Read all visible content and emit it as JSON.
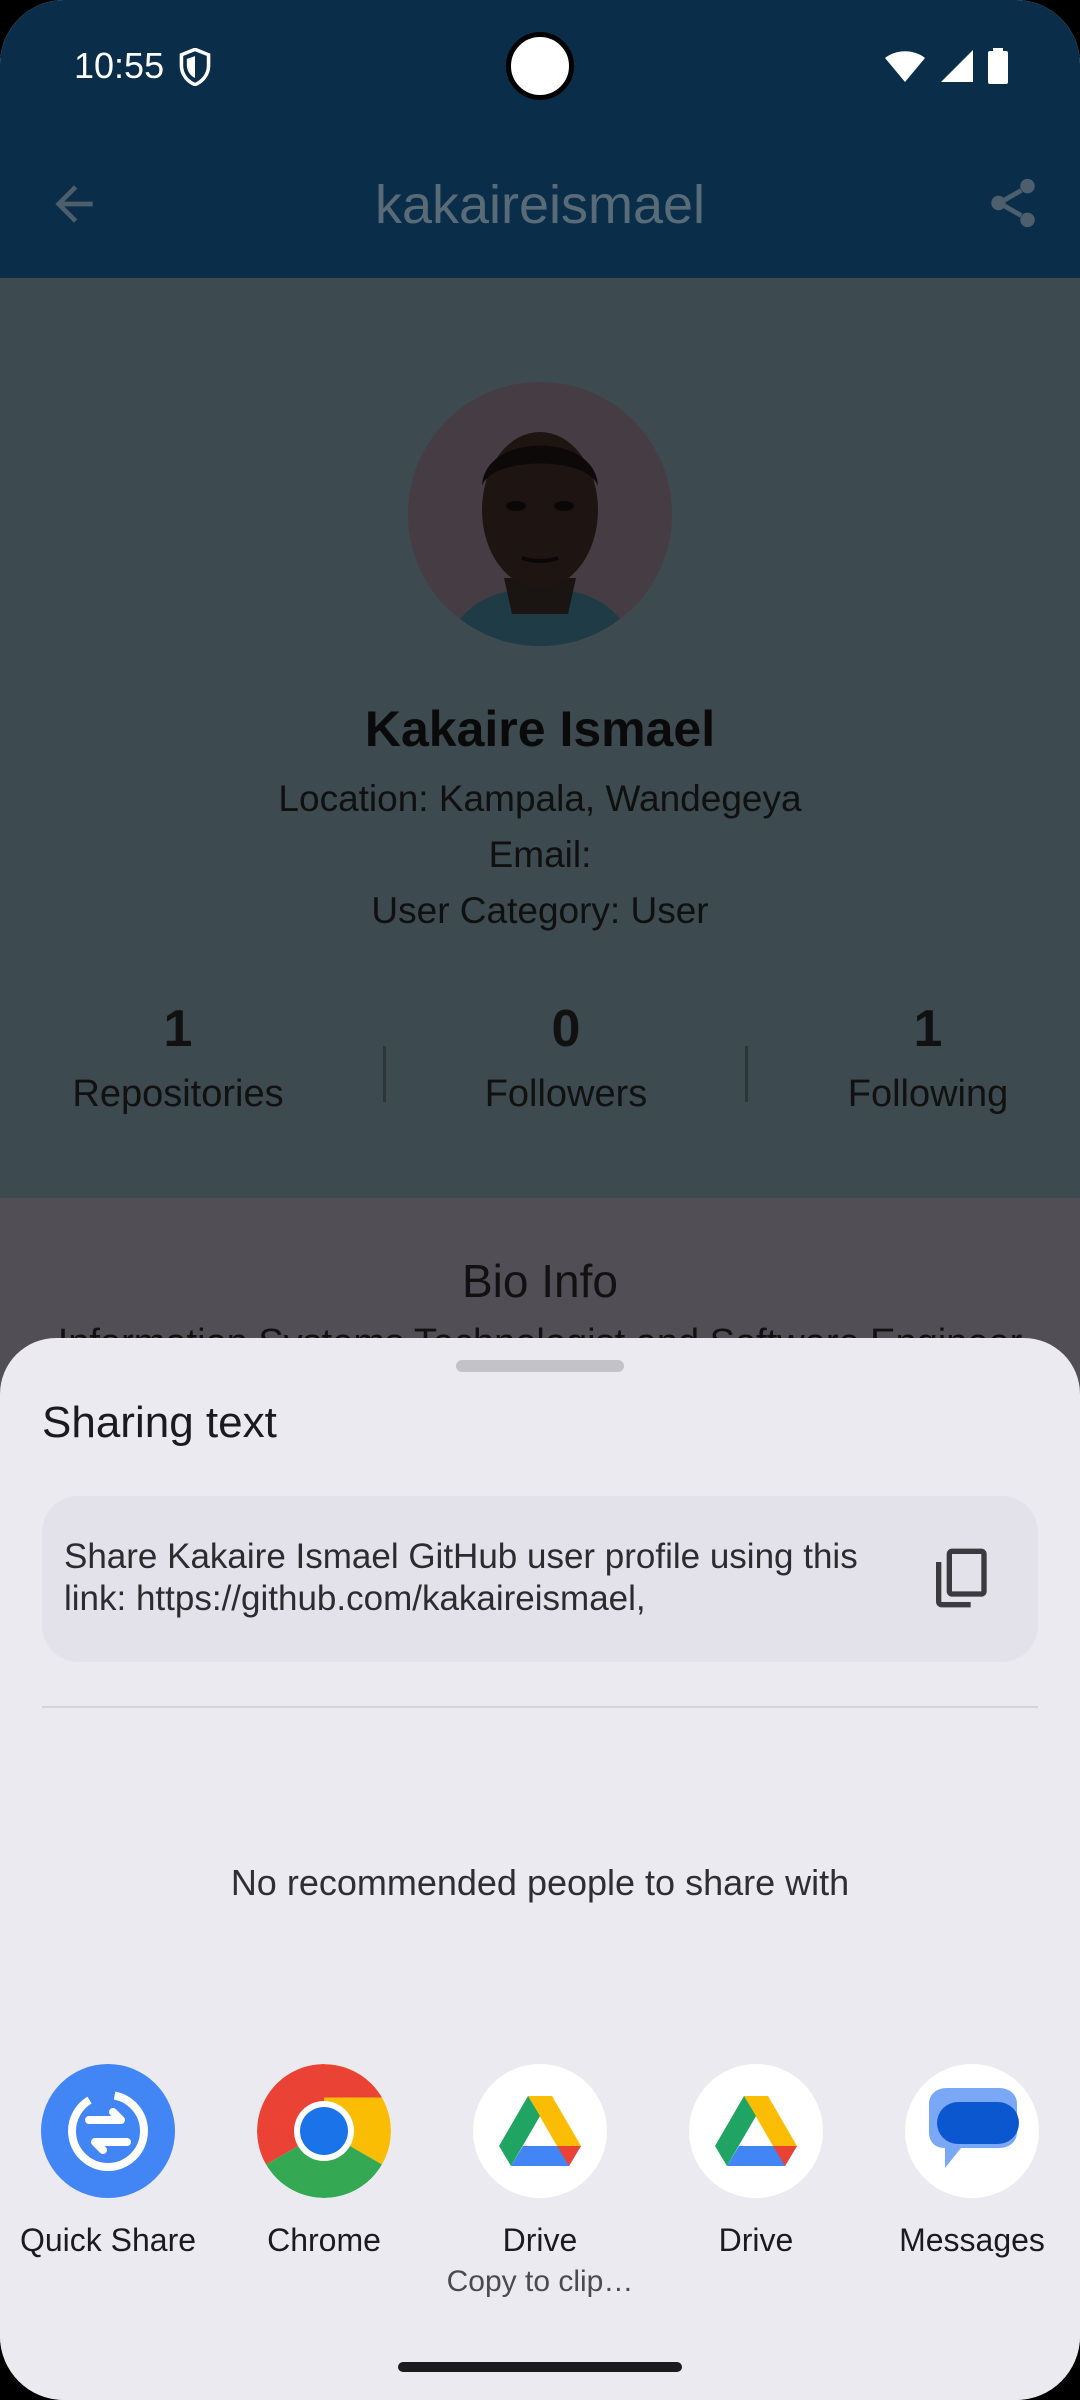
{
  "status_bar": {
    "time": "10:55"
  },
  "app_bar": {
    "title": "kakaireismael"
  },
  "profile": {
    "name": "Kakaire Ismael",
    "location": "Location: Kampala, Wandegeya",
    "email": "Email:",
    "category": "User Category: User"
  },
  "stats": [
    {
      "value": "1",
      "label": "Repositories"
    },
    {
      "value": "0",
      "label": "Followers"
    },
    {
      "value": "1",
      "label": "Following"
    }
  ],
  "bio": {
    "title": "Bio Info",
    "text": "Information Systems Technologist and Software Engineer"
  },
  "share_sheet": {
    "title": "Sharing text",
    "preview_text": "Share Kakaire Ismael GitHub user profile using this link: https://github.com/kakaireismael,",
    "no_recommend": "No recommended people to share with",
    "apps": [
      {
        "label": "Quick Share",
        "sublabel": "",
        "icon": "quick-share-icon"
      },
      {
        "label": "Chrome",
        "sublabel": "",
        "icon": "chrome-icon"
      },
      {
        "label": "Drive",
        "sublabel": "Copy to clip…",
        "icon": "drive-icon"
      },
      {
        "label": "Drive",
        "sublabel": "",
        "icon": "drive-icon"
      },
      {
        "label": "Messages",
        "sublabel": "",
        "icon": "messages-icon"
      }
    ]
  },
  "colors": {
    "app_bar": "#0a2e49",
    "scrim_profile": "#3d4a4f",
    "sheet_background": "#eceaf1",
    "quick_share_blue": "#4285f4"
  }
}
